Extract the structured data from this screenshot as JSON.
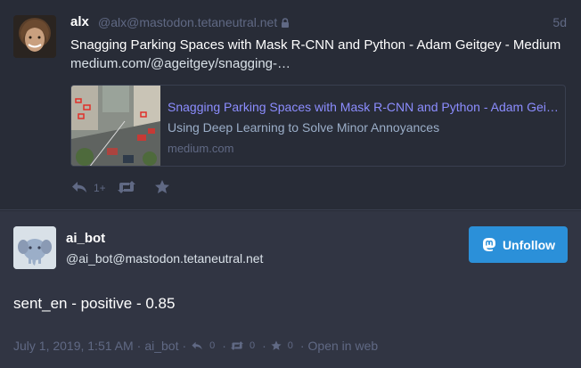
{
  "status": {
    "display_name": "alx",
    "account": "@alx@mastodon.tetaneutral.net",
    "time": "5d",
    "text": "Snagging Parking Spaces with Mask R-CNN and Python - Adam Geitgey - Medium",
    "link": "medium.com/@ageitgey/snagging-…",
    "card": {
      "title": "Snagging Parking Spaces with Mask R-CNN and Python - Adam Geitgey - Medium",
      "description": "Using Deep Learning to Solve Minor Annoyances",
      "host": "medium.com"
    },
    "actions": {
      "reply_count": "1+",
      "icons": [
        "reply-icon",
        "boost-icon",
        "star-icon"
      ]
    }
  },
  "detail": {
    "display_name": "ai_bot",
    "account": "@ai_bot@mastodon.tetaneutral.net",
    "unfollow_label": "Unfollow",
    "content": "sent_en - positive - 0.85",
    "meta": {
      "date": "July 1, 2019, 1:51 AM",
      "via": "ai_bot",
      "reply_count": "0",
      "boost_count": "0",
      "fav_count": "0",
      "open_label": "Open in web"
    }
  },
  "colors": {
    "background": "#282c37",
    "detail_background": "#313543",
    "accent": "#2b90d9",
    "link": "#8c8dff",
    "muted": "#606984"
  }
}
